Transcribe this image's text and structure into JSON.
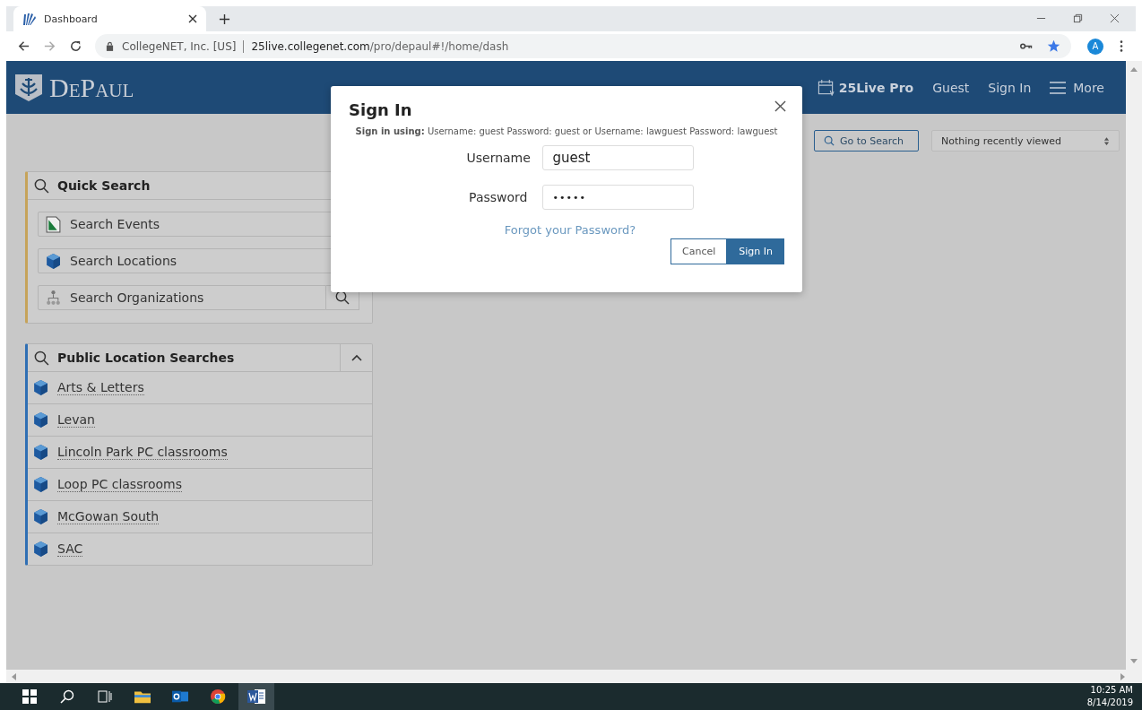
{
  "browser": {
    "tab": {
      "title": "Dashboard"
    },
    "site_identity": "CollegeNET, Inc. [US]",
    "url_host": "25live.collegenet.com",
    "url_path": "/pro/depaul#!/home/dash",
    "profile_initial": "A"
  },
  "header": {
    "logo": "DePaul",
    "nav": [
      {
        "label": "25Live Pro",
        "kind": "product"
      },
      {
        "label": "Guest",
        "kind": "link"
      },
      {
        "label": "Sign In",
        "kind": "link"
      },
      {
        "label": "More",
        "kind": "menu"
      }
    ]
  },
  "toolbar": {
    "go_to_search": "Go to Search",
    "recent": "Nothing recently viewed"
  },
  "quick_search": {
    "title": "Quick Search",
    "items": [
      {
        "label": "Search Events",
        "kind": "events",
        "search_button": false
      },
      {
        "label": "Search Locations",
        "kind": "locations",
        "search_button": false
      },
      {
        "label": "Search Organizations",
        "kind": "organizations",
        "search_button": true
      }
    ]
  },
  "public_location_searches": {
    "title": "Public Location Searches",
    "expanded": true,
    "items": [
      {
        "label": "Arts & Letters"
      },
      {
        "label": "Levan"
      },
      {
        "label": "Lincoln Park PC classrooms"
      },
      {
        "label": "Loop PC classrooms"
      },
      {
        "label": "McGowan South"
      },
      {
        "label": "SAC"
      }
    ]
  },
  "dialog": {
    "title": "Sign In",
    "hint": "**Sign in using:** Username: guest Password: guest or Username: lawguest Password: lawguest",
    "fields": [
      {
        "label": "Username",
        "value": "guest",
        "kind": "text"
      },
      {
        "label": "Password",
        "value": "•••••",
        "kind": "password"
      }
    ],
    "forgot_link": "Forgot your Password?",
    "buttons": [
      {
        "label": "Cancel",
        "primary": false
      },
      {
        "label": "Sign In",
        "primary": true
      }
    ]
  },
  "taskbar": {
    "time": "10:25 AM",
    "date": "8/14/2019"
  }
}
